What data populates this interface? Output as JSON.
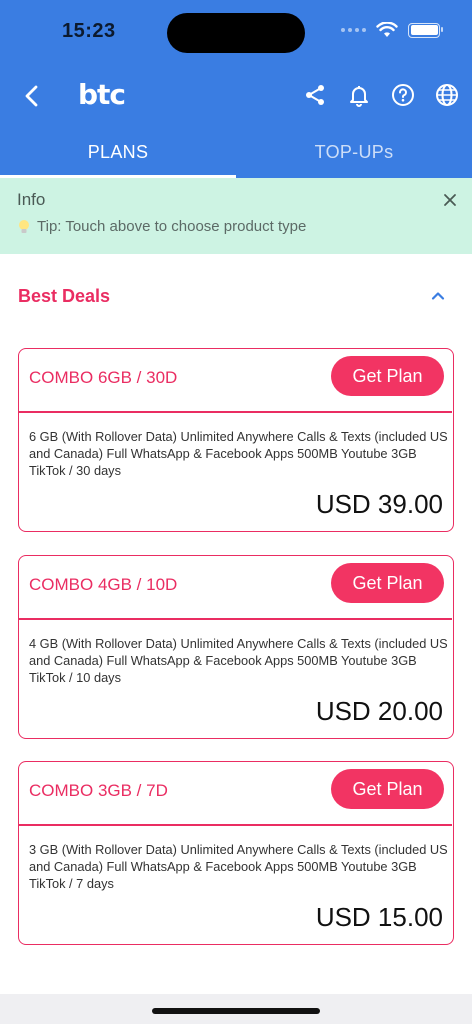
{
  "status": {
    "time": "15:23"
  },
  "header": {
    "logo": "btc"
  },
  "tabs": [
    {
      "label": "PLANS",
      "active": true
    },
    {
      "label": "TOP-UPs",
      "active": false
    }
  ],
  "info": {
    "title": "Info",
    "tip": "Tip: Touch above to choose product type"
  },
  "section": {
    "title": "Best Deals"
  },
  "plans": [
    {
      "title": "COMBO 6GB / 30D",
      "button": "Get Plan",
      "description": "6 GB (With Rollover Data) Unlimited Anywhere Calls & Texts (included US and Canada) Full WhatsApp & Facebook Apps 500MB Youtube 3GB TikTok / 30 days",
      "price": "USD 39.00"
    },
    {
      "title": "COMBO 4GB / 10D",
      "button": "Get Plan",
      "description": "4 GB (With Rollover Data) Unlimited Anywhere Calls & Texts (included US and Canada) Full WhatsApp & Facebook Apps 500MB Youtube 3GB TikTok / 10 days",
      "price": "USD 20.00"
    },
    {
      "title": "COMBO 3GB / 7D",
      "button": "Get Plan",
      "description": "3 GB (With Rollover Data) Unlimited Anywhere Calls & Texts (included US and Canada) Full WhatsApp & Facebook Apps 500MB Youtube 3GB TikTok / 7 days",
      "price": "USD 15.00"
    }
  ],
  "icons": {
    "back": "chevron-left-icon",
    "share": "share-icon",
    "notifications": "bell-icon",
    "help": "question-circle-icon",
    "language": "globe-icon",
    "close": "close-icon",
    "collapse": "chevron-up-icon",
    "tip": "lightbulb-icon"
  },
  "colors": {
    "header": "#3a7de2",
    "accent": "#ea2d62",
    "button": "#f23463",
    "info_bg": "#cdf3e3"
  }
}
